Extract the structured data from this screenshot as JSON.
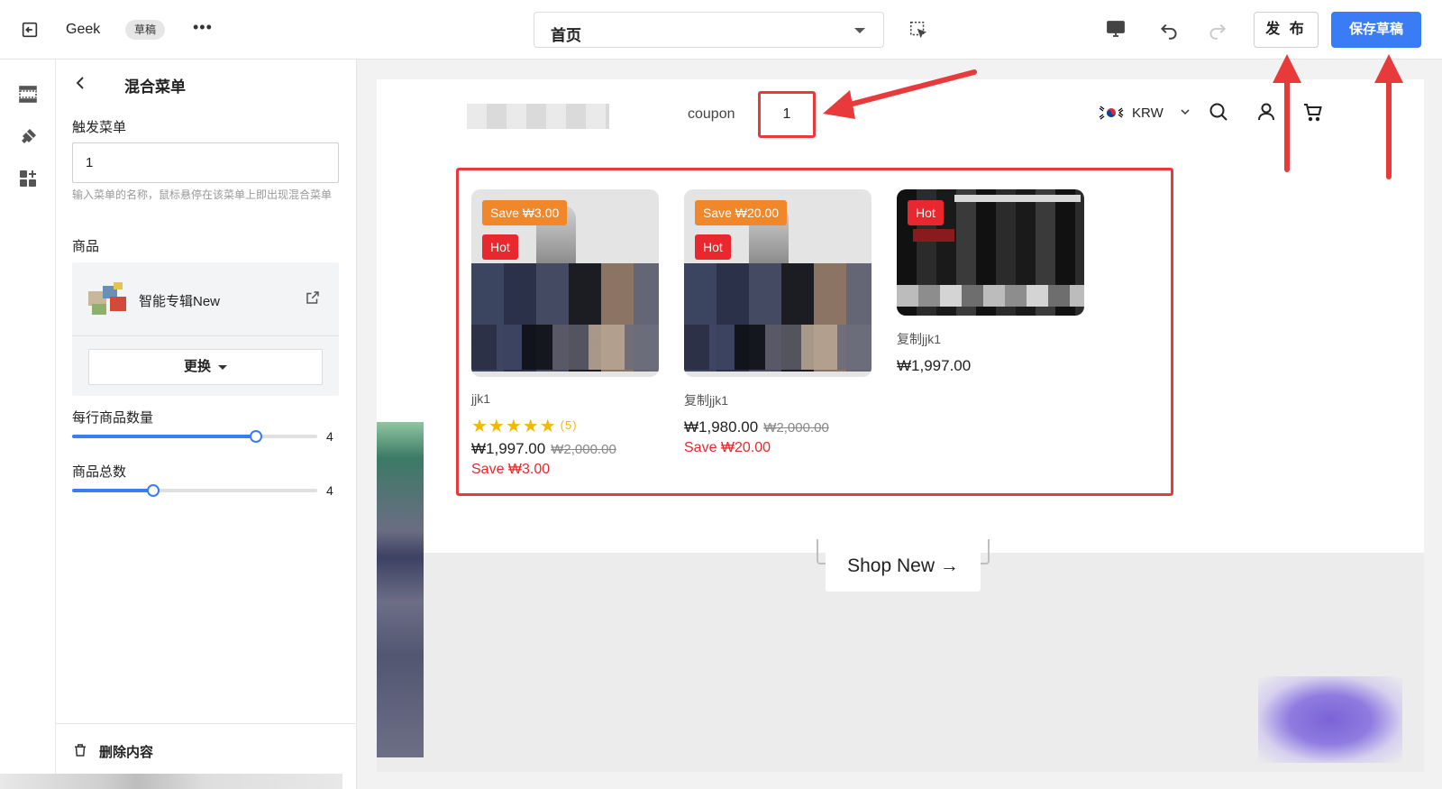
{
  "topbar": {
    "site_name": "Geek",
    "draft_badge": "草稿",
    "more": "•••",
    "page_selector": "首页",
    "publish_label": "发 布",
    "save_label": "保存草稿"
  },
  "panel": {
    "title": "混合菜单",
    "trigger_label": "触发菜单",
    "trigger_value": "1",
    "trigger_hint": "输入菜单的名称，鼠标悬停在该菜单上即出现混合菜单",
    "product_label": "商品",
    "product_name": "智能专辑New",
    "replace_label": "更换",
    "per_row_label": "每行商品数量",
    "per_row_value": "4",
    "per_row_fraction": 0.75,
    "total_label": "商品总数",
    "total_value": "4",
    "total_fraction": 0.33,
    "delete_label": "删除内容"
  },
  "preview": {
    "coupon_label": "coupon",
    "coupon_menu_value": "1",
    "currency": "KRW",
    "shop_new": "Shop New →",
    "products": [
      {
        "name": "jjk1",
        "save_badge": "Save ₩3.00",
        "hot_badge": "Hot",
        "stars": "★★★★★",
        "rating_count": "(5)",
        "price": "₩1,997.00",
        "old_price": "₩2,000.00",
        "save_text": "Save ₩3.00"
      },
      {
        "name": "复制jjk1",
        "save_badge": "Save ₩20.00",
        "hot_badge": "Hot",
        "price": "₩1,980.00",
        "old_price": "₩2,000.00",
        "save_text": "Save ₩20.00"
      },
      {
        "name": "复制jjk1",
        "hot_badge": "Hot",
        "price": "₩1,997.00"
      }
    ]
  },
  "colors": {
    "accent": "#3a7cf6",
    "annotation_red": "#e83a3a",
    "save_badge": "#f0872b",
    "hot_badge": "#e8282e"
  }
}
